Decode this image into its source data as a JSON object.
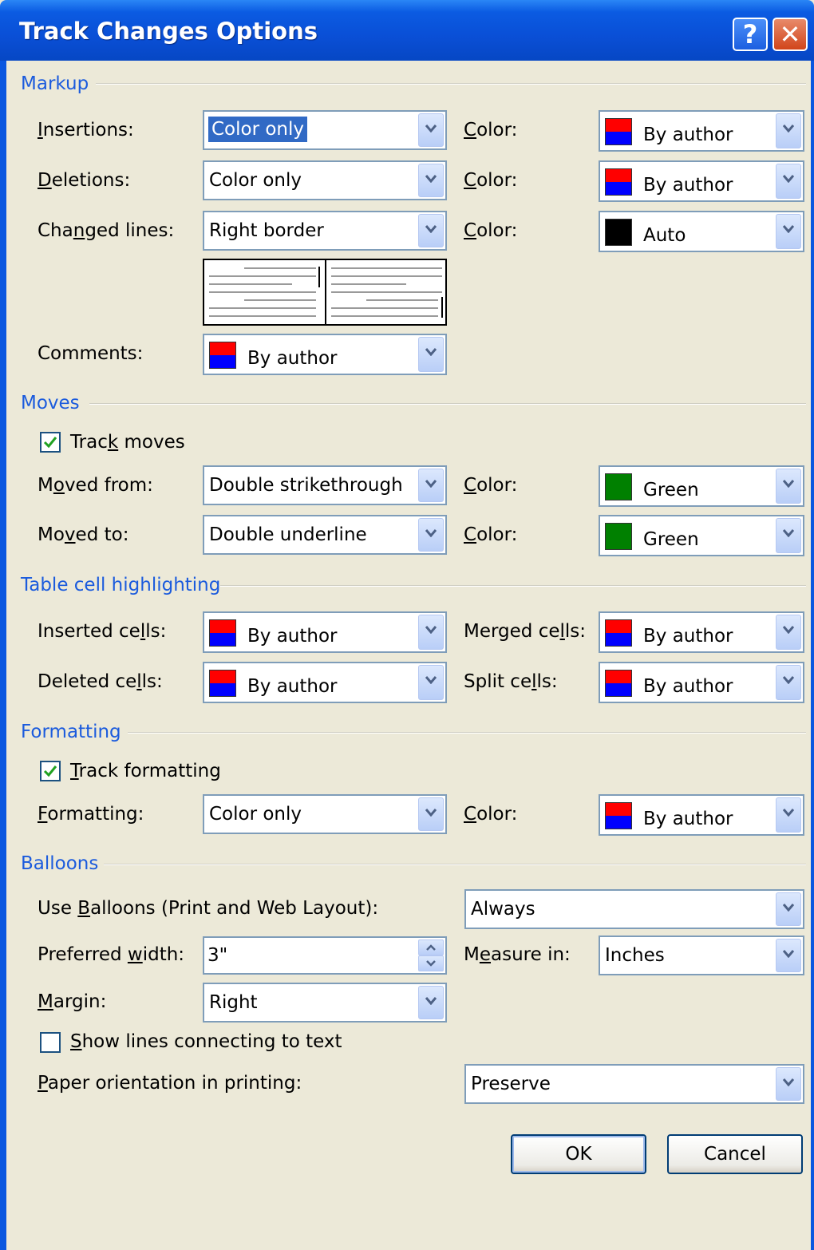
{
  "window": {
    "title": "Track Changes Options",
    "help_glyph": "?",
    "close_glyph": "✕"
  },
  "markup": {
    "heading": "Markup",
    "insertions": {
      "label_pre": "",
      "label_u": "I",
      "label_post": "nsertions:",
      "value": "Color only",
      "color_label": "Color:",
      "color_value": "By author"
    },
    "deletions": {
      "label_u": "D",
      "label_post": "eletions:",
      "value": "Color only",
      "color_label": "Color:",
      "color_value": "By author"
    },
    "changed_lines": {
      "label_pre": "Cha",
      "label_u": "n",
      "label_post": "ged lines:",
      "value": "Right border",
      "color_label": "Color:",
      "color_value": "Auto"
    },
    "comments": {
      "label": "Comments:",
      "value": "By author"
    }
  },
  "moves": {
    "heading": "Moves",
    "track_label_pre": "Trac",
    "track_label_u": "k",
    "track_label_post": " moves",
    "track_checked": true,
    "moved_from": {
      "label_pre": "M",
      "label_u": "o",
      "label_post": "ved from:",
      "value": "Double strikethrough",
      "color_label": "Color:",
      "color_value": "Green"
    },
    "moved_to": {
      "label_pre": "Mo",
      "label_u": "v",
      "label_post": "ed to:",
      "value": "Double underline",
      "color_label": "Color:",
      "color_value": "Green"
    }
  },
  "table_cells": {
    "heading": "Table cell highlighting",
    "inserted": {
      "label_pre": "Inserted ce",
      "label_u": "l",
      "label_post": "ls:",
      "value": "By author"
    },
    "deleted": {
      "label_pre": "Deleted ce",
      "label_u": "l",
      "label_post": "ls:",
      "value": "By author"
    },
    "merged": {
      "label_pre": "Merged ce",
      "label_u": "l",
      "label_post": "ls:",
      "value": "By author"
    },
    "split": {
      "label_pre": "Split ce",
      "label_u": "l",
      "label_post": "ls:",
      "value": "By author"
    }
  },
  "formatting": {
    "heading": "Formatting",
    "track_label_u": "T",
    "track_label_post": "rack formatting",
    "track_checked": true,
    "formatting": {
      "label_u": "F",
      "label_post": "ormatting:",
      "value": "Color only",
      "color_label": "Color:",
      "color_value": "By author"
    }
  },
  "balloons": {
    "heading": "Balloons",
    "use_label_pre": "Use ",
    "use_label_u": "B",
    "use_label_post": "alloons (Print and Web Layout):",
    "use_value": "Always",
    "width_label_pre": "Preferred ",
    "width_label_u": "w",
    "width_label_post": "idth:",
    "width_value": "3\"",
    "measure_label_pre": "M",
    "measure_label_u": "e",
    "measure_label_post": "asure in:",
    "measure_value": "Inches",
    "margin_label_u": "M",
    "margin_label_post": "argin:",
    "margin_value": "Right",
    "show_lines_label_u": "S",
    "show_lines_label_post": "how lines connecting to text",
    "show_lines_checked": false,
    "paper_label_u": "P",
    "paper_label_post": "aper orientation in printing:",
    "paper_value": "Preserve"
  },
  "buttons": {
    "ok": "OK",
    "cancel": "Cancel"
  },
  "colors": {
    "accent": "#1B5BDD",
    "titlebar": "#0A4FD6",
    "dialog_bg": "#ECE9D8",
    "selection": "#316AC5"
  }
}
